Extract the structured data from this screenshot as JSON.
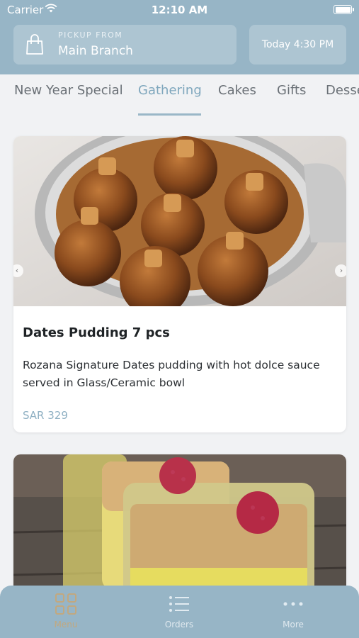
{
  "status_bar": {
    "carrier": "Carrier",
    "time": "12:10 AM"
  },
  "header": {
    "pickup_label": "PICKUP FROM",
    "pickup_value": "Main Branch",
    "time_button": "Today 4:30 PM"
  },
  "tabs": [
    "New Year Special",
    "Gathering",
    "Cakes",
    "Gifts",
    "Desse"
  ],
  "active_tab": "Gathering",
  "products": [
    {
      "title": "Dates Pudding 7 pcs",
      "description": "Rozana Signature Dates pudding with hot dolce sauce served in Glass/Ceramic bowl",
      "price": "SAR 329"
    }
  ],
  "tab_bar": {
    "items": [
      {
        "label": "Menu",
        "icon": "grid-icon"
      },
      {
        "label": "Orders",
        "icon": "list-icon"
      },
      {
        "label": "More",
        "icon": "more-dots-icon"
      }
    ]
  },
  "colors": {
    "header": "#97b5c6",
    "accent": "#7fa7bd",
    "price": "#8fb0c3",
    "active_tab_bar": "#c2a87f"
  }
}
